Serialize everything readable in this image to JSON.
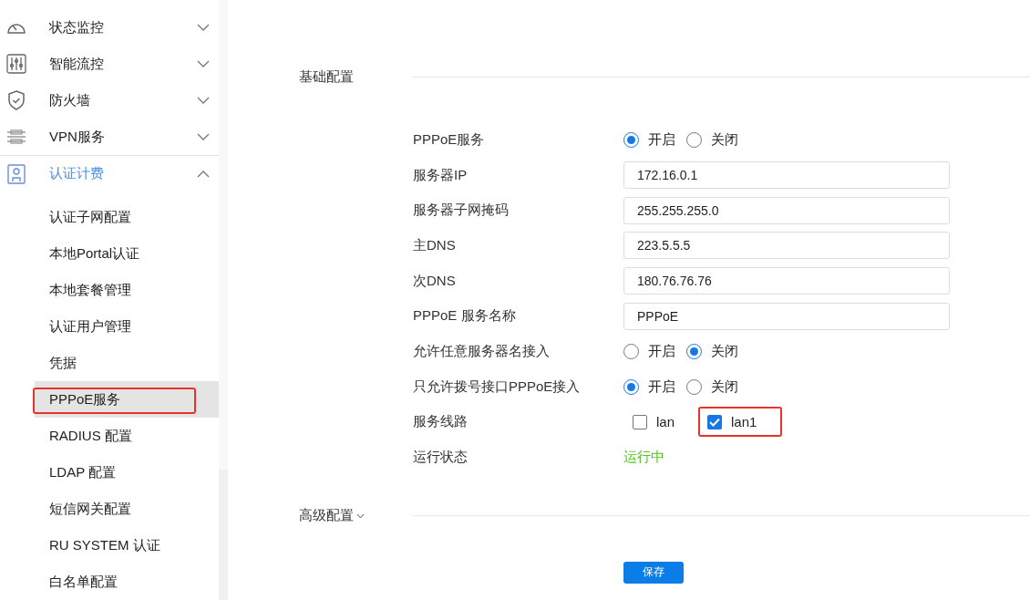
{
  "sidebar": {
    "items": [
      {
        "label": "状态监控",
        "expanded": false,
        "active": false
      },
      {
        "label": "智能流控",
        "expanded": false,
        "active": false
      },
      {
        "label": "防火墙",
        "expanded": false,
        "active": false
      },
      {
        "label": "VPN服务",
        "expanded": false,
        "active": false
      },
      {
        "label": "认证计费",
        "expanded": true,
        "active": true,
        "children": [
          {
            "label": "认证子网配置",
            "selected": false,
            "highlighted": false
          },
          {
            "label": "本地Portal认证",
            "selected": false,
            "highlighted": false
          },
          {
            "label": "本地套餐管理",
            "selected": false,
            "highlighted": false
          },
          {
            "label": "认证用户管理",
            "selected": false,
            "highlighted": false
          },
          {
            "label": "凭据",
            "selected": false,
            "highlighted": false
          },
          {
            "label": "PPPoE服务",
            "selected": true,
            "highlighted": true
          },
          {
            "label": "RADIUS 配置",
            "selected": false,
            "highlighted": false
          },
          {
            "label": "LDAP 配置",
            "selected": false,
            "highlighted": false
          },
          {
            "label": "短信网关配置",
            "selected": false,
            "highlighted": false
          },
          {
            "label": "RU SYSTEM 认证",
            "selected": false,
            "highlighted": false
          },
          {
            "label": "白名单配置",
            "selected": false,
            "highlighted": false
          }
        ]
      }
    ]
  },
  "basic_section": {
    "title": "基础配置",
    "rows": [
      {
        "kind": "radio",
        "label": "PPPoE服务",
        "options": [
          {
            "label": "开启",
            "selected": true
          },
          {
            "label": "关闭",
            "selected": false
          }
        ]
      },
      {
        "kind": "input",
        "label": "服务器IP",
        "value": "172.16.0.1"
      },
      {
        "kind": "input",
        "label": "服务器子网掩码",
        "value": "255.255.255.0"
      },
      {
        "kind": "input",
        "label": "主DNS",
        "value": "223.5.5.5"
      },
      {
        "kind": "input",
        "label": "次DNS",
        "value": "180.76.76.76"
      },
      {
        "kind": "input",
        "label": "PPPoE 服务名称",
        "value": "PPPoE"
      },
      {
        "kind": "radio",
        "label": "允许任意服务器名接入",
        "options": [
          {
            "label": "开启",
            "selected": false
          },
          {
            "label": "关闭",
            "selected": true
          }
        ]
      },
      {
        "kind": "radio",
        "label": "只允许拨号接口PPPoE接入",
        "options": [
          {
            "label": "开启",
            "selected": true
          },
          {
            "label": "关闭",
            "selected": false
          }
        ]
      },
      {
        "kind": "checkbox",
        "label": "服务线路",
        "options": [
          {
            "label": "lan",
            "checked": false,
            "highlighted": false
          },
          {
            "label": "lan1",
            "checked": true,
            "highlighted": true
          }
        ]
      },
      {
        "kind": "status",
        "label": "运行状态",
        "value": "运行中",
        "color": "#52c41a"
      }
    ]
  },
  "advanced_section": {
    "title": "高级配置",
    "expanded": false
  },
  "save_button": "保存"
}
